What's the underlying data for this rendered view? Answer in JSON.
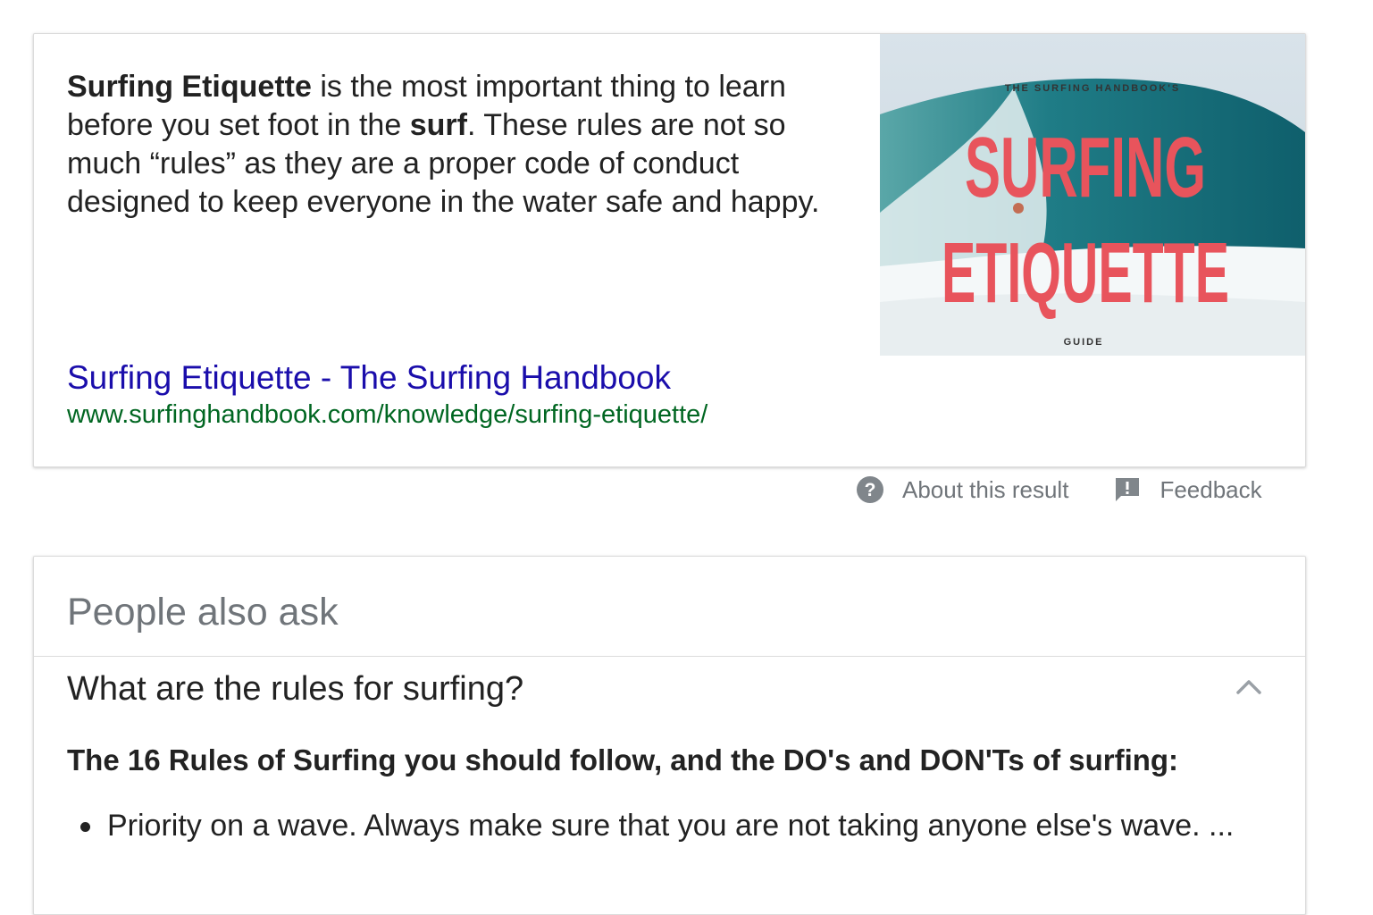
{
  "snippet": {
    "text_parts": [
      {
        "text": "Surfing Etiquette",
        "bold": true
      },
      {
        "text": " is the most important thing to learn before you set foot in the ",
        "bold": false
      },
      {
        "text": "surf",
        "bold": true
      },
      {
        "text": ". These rules are not so much “rules” as they are a proper code of conduct designed to keep everyone in the water safe and happy.",
        "bold": false
      }
    ],
    "image": {
      "top_text": "THE SURFING HANDBOOK'S",
      "line1": "SURFING",
      "line2": "ETIQUETTE",
      "bottom_text": "GUIDE",
      "title_color": "#e8545c"
    },
    "link_title": "Surfing Etiquette - The Surfing Handbook",
    "url": "www.surfinghandbook.com/knowledge/surfing-etiquette/"
  },
  "meta": {
    "about_label": "About this result",
    "about_icon": "help-circle-icon",
    "feedback_label": "Feedback",
    "feedback_icon": "feedback-icon"
  },
  "paa": {
    "title": "People also ask",
    "question": "What are the rules for surfing?",
    "answer_heading": "The 16 Rules of Surfing you should follow, and the DO's and DON'Ts of surfing:",
    "answer_items": [
      "Priority on a wave. Always make sure that you are not taking anyone else's wave. ..."
    ]
  },
  "colors": {
    "link": "#1a0dab",
    "url": "#006621",
    "muted": "#70757a"
  }
}
